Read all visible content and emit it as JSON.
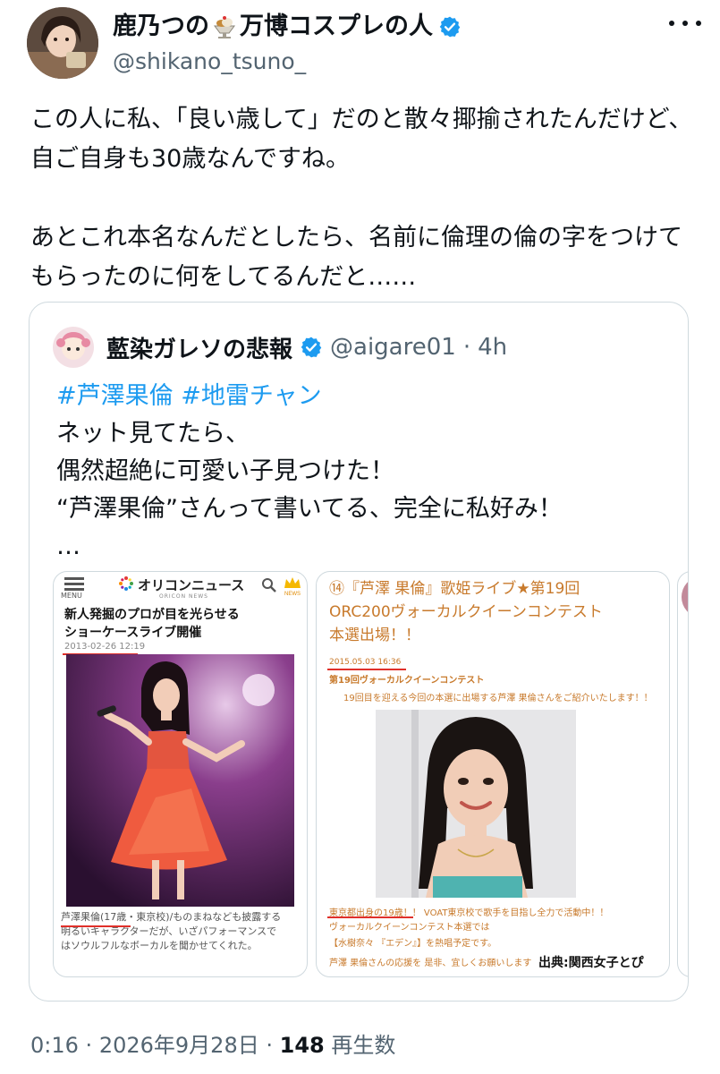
{
  "author": {
    "display_name_part1": "鹿乃つの",
    "display_name_part2": "万博コスプレの人",
    "handle": "@shikano_tsuno_",
    "verified_color": "#1d9bf0"
  },
  "post": {
    "text": "この人に私、「良い歳して」だのと散々揶揄されたんだけど、自ご自身も30歳なんですね。\n\nあとこれ本名なんだとしたら、名前に倫理の倫の字をつけてもらったのに何をしてるんだと……"
  },
  "quote": {
    "display_name": "藍染ガレソの悲報",
    "handle": "@aigare01",
    "separator": "·",
    "time": "4h",
    "hashtag1": "#芦澤果倫",
    "hashtag2": "#地雷チャン",
    "body": "ネット見てたら、\n偶然超絶に可愛い子見つけた！\n“芦澤果倫”さんって書いてる、完全に私好み！\n…"
  },
  "media1": {
    "menu_label": "MENU",
    "logo_title": "オリコンニュース",
    "logo_sub": "ORICON NEWS",
    "crown_label": "NEWS",
    "headline": "新人発掘のプロが目を光らせる\nショーケースライブ開催",
    "date": "2013-02-26 12:19",
    "caption": "芦澤果倫(17歳・東京校)/ものまねなども披露する\n明るいキャラクターだが、いざパフォーマンスで\nはソウルフルなボーカルを聞かせてくれた。"
  },
  "media2": {
    "title": "⑭『芦澤 果倫』歌姫ライブ★第19回\nORC200ヴォーカルクイーンコンテスト\n本選出場！！",
    "date": "2015.05.03 16:36",
    "subheading": "第19回ヴォーカルクイーンコンテスト",
    "intro": "19回目を迎える今回の本選に出場する芦澤 果倫さんをご紹介いたします！！",
    "line1": "東京都出身の19歳！！ VOAT東京校で歌手を目指し全力で活動中！！",
    "line2": "ヴォーカルクイーンコンテスト本選では",
    "line3": "【水樹奈々 『エデン』】を熱唱予定です。",
    "line4": "芦澤 果倫さんの応援を 是非、宜しくお願いします",
    "credit": "出典:関西女子とぴ"
  },
  "meta": {
    "time": "0:16",
    "dot1": "·",
    "date": "2026年9月28日",
    "dot2": "·",
    "views": "148",
    "views_label": "再生数"
  }
}
